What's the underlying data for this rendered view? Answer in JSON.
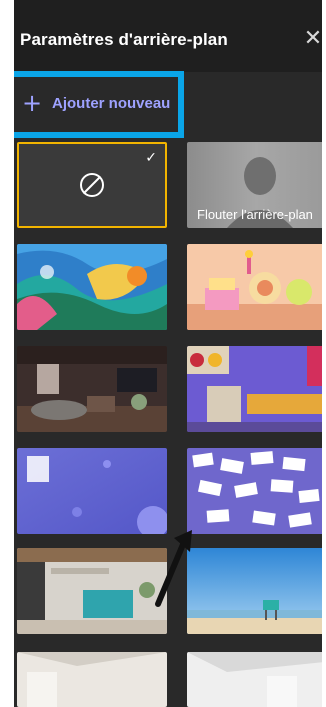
{
  "header": {
    "title": "Paramètres d'arrière-plan",
    "close_glyph": "✕"
  },
  "actions": {
    "add_glyph": "+",
    "add_label": "Ajouter nouveau"
  },
  "tiles": {
    "none": {
      "icon": "no-background-icon",
      "check_glyph": "✓",
      "selected": true
    },
    "blur": {
      "label": "Flouter l'arrière-plan"
    }
  },
  "colors": {
    "panel_bg": "#292929",
    "accent": "#9ea2ff",
    "highlight_frame": "#0aa5e8",
    "selected_border": "#f2b400"
  }
}
